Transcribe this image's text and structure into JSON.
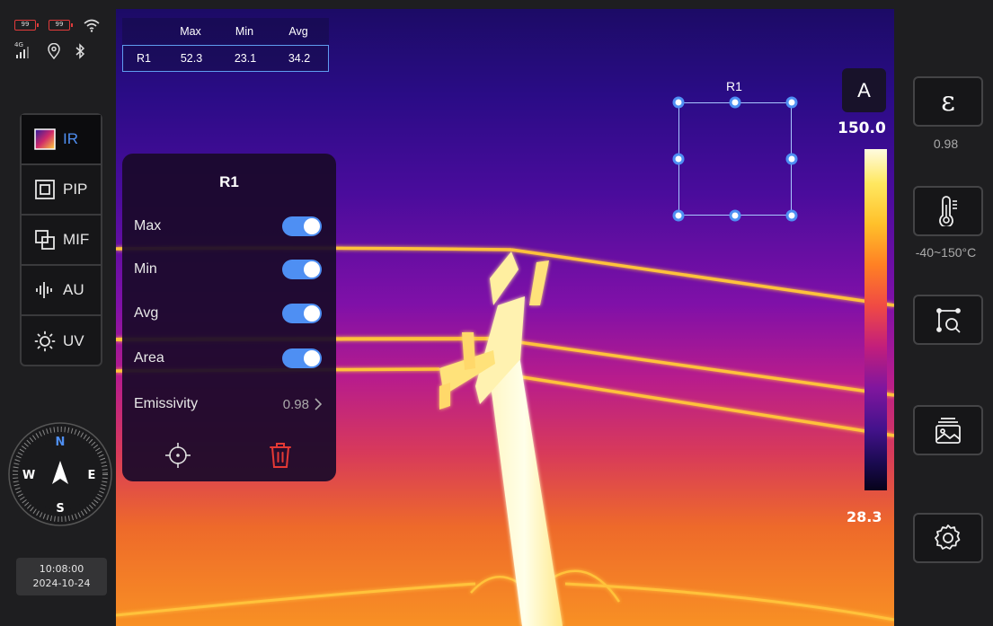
{
  "status": {
    "battery_1": "99",
    "battery_2": "99",
    "signal": "4G"
  },
  "modes": [
    {
      "label": "IR"
    },
    {
      "label": "PIP"
    },
    {
      "label": "MIF"
    },
    {
      "label": "AU"
    },
    {
      "label": "UV"
    }
  ],
  "compass": {
    "north": "N",
    "east": "E",
    "south": "S",
    "west": "W"
  },
  "datetime": {
    "time": "10:08:00",
    "date": "2024-10-24"
  },
  "measurement_table": {
    "headers": [
      "Max",
      "Min",
      "Avg"
    ],
    "rows": [
      {
        "name": "R1",
        "max": "52.3",
        "min": "23.1",
        "avg": "34.2"
      }
    ]
  },
  "roi": {
    "label": "R1"
  },
  "panel": {
    "title": "R1",
    "toggles": [
      {
        "label": "Max",
        "on": true
      },
      {
        "label": "Min",
        "on": true
      },
      {
        "label": "Avg",
        "on": true
      },
      {
        "label": "Area",
        "on": true
      }
    ],
    "emissivity_label": "Emissivity",
    "emissivity_value": "0.98"
  },
  "scale": {
    "mode": "A",
    "max": "150.0",
    "min": "28.3"
  },
  "toolbar": {
    "emissivity_symbol": "ε",
    "emissivity_value": "0.98",
    "range_value": "-40~150°C"
  },
  "colors": {
    "accent": "#4e8ff3",
    "delete": "#e53935",
    "panel_border": "#3a3a3c"
  }
}
